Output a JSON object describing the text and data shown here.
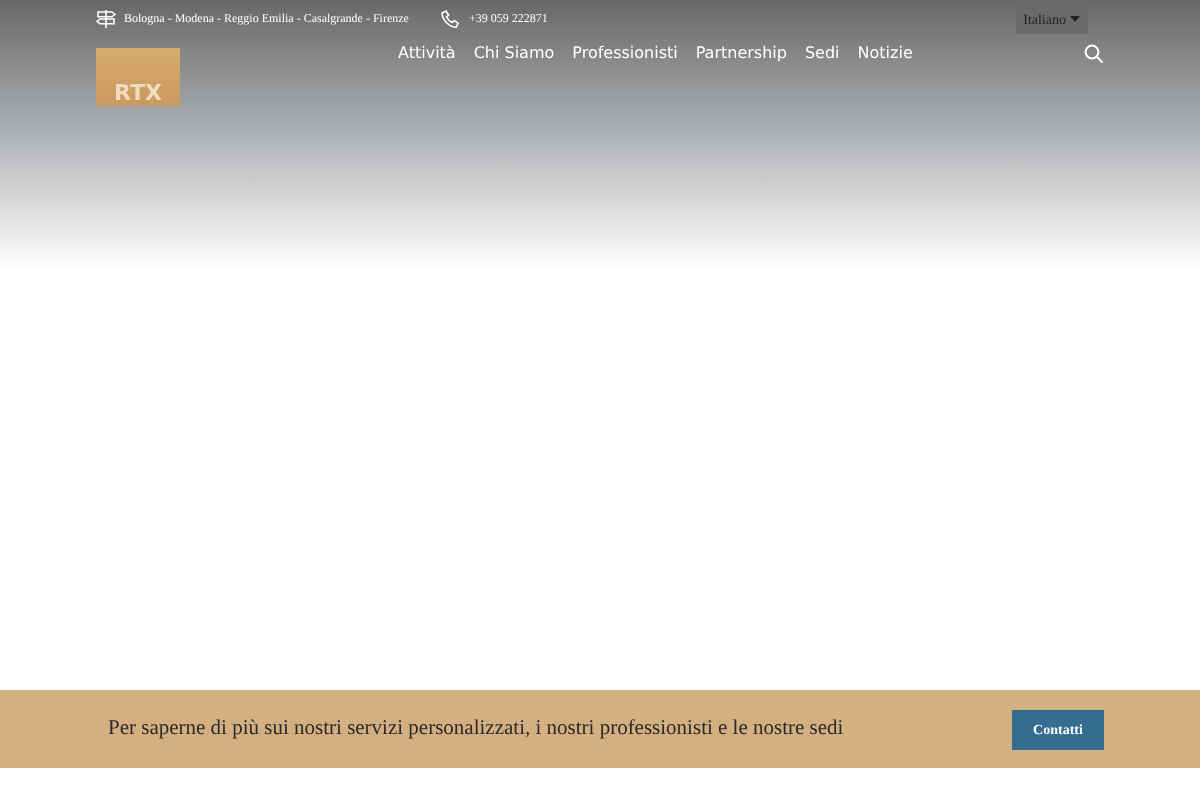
{
  "topbar": {
    "locations": "Bologna - Modena - Reggio Emilia - Casalgrande - Firenze",
    "phone": "+39 059 222871",
    "language": "Italiano"
  },
  "logo": {
    "text": "RTX"
  },
  "nav": [
    {
      "label": "Attività"
    },
    {
      "label": "Chi Siamo"
    },
    {
      "label": "Professionisti"
    },
    {
      "label": "Partnership"
    },
    {
      "label": "Sedi"
    },
    {
      "label": "Notizie"
    }
  ],
  "cta": {
    "text": "Per saperne di più sui nostri servizi personalizzati, i nostri professionisti e le nostre sedi",
    "button": "Contatti"
  }
}
